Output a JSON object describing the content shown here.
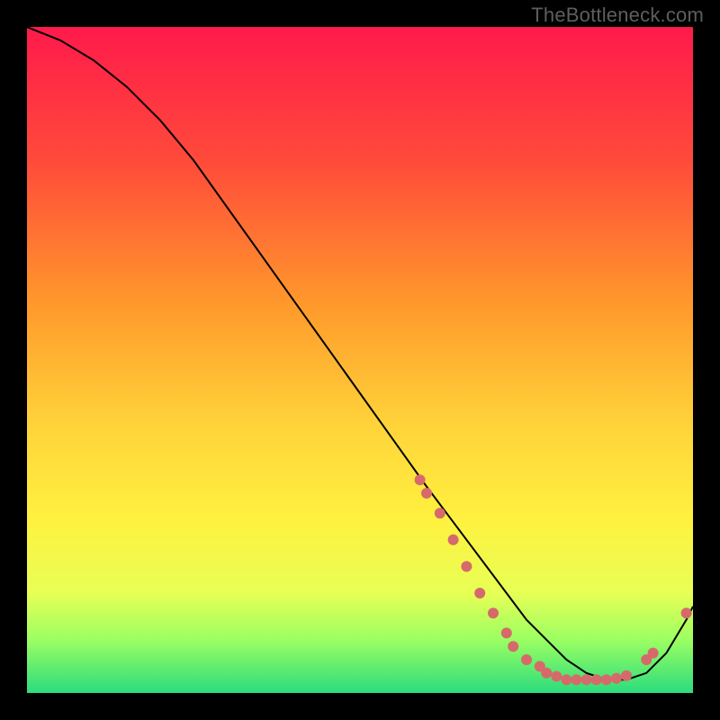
{
  "watermark": "TheBottleneck.com",
  "colors": {
    "bg": "#000000",
    "curve": "#000000",
    "marker": "#d66a6a",
    "gradient_stops": [
      {
        "offset": 0.0,
        "color": "#ff1a4b"
      },
      {
        "offset": 0.2,
        "color": "#ff4a3a"
      },
      {
        "offset": 0.42,
        "color": "#ff9a2b"
      },
      {
        "offset": 0.6,
        "color": "#ffd43a"
      },
      {
        "offset": 0.74,
        "color": "#fff13f"
      },
      {
        "offset": 0.85,
        "color": "#e7ff55"
      },
      {
        "offset": 0.92,
        "color": "#9bff62"
      },
      {
        "offset": 1.0,
        "color": "#2bdc7d"
      }
    ]
  },
  "chart_data": {
    "type": "line",
    "title": "",
    "xlabel": "",
    "ylabel": "",
    "xlim": [
      0,
      100
    ],
    "ylim": [
      0,
      100
    ],
    "series": [
      {
        "name": "curve",
        "x": [
          0,
          5,
          10,
          15,
          20,
          25,
          30,
          35,
          40,
          45,
          50,
          55,
          60,
          63,
          66,
          69,
          72,
          75,
          78,
          81,
          84,
          87,
          90,
          93,
          96,
          99,
          100
        ],
        "y": [
          100,
          98,
          95,
          91,
          86,
          80,
          73,
          66,
          59,
          52,
          45,
          38,
          31,
          27,
          23,
          19,
          15,
          11,
          8,
          5,
          3,
          2,
          2,
          3,
          6,
          11,
          13
        ]
      }
    ],
    "markers": [
      {
        "x": 59,
        "y": 32
      },
      {
        "x": 60,
        "y": 30
      },
      {
        "x": 62,
        "y": 27
      },
      {
        "x": 64,
        "y": 23
      },
      {
        "x": 66,
        "y": 19
      },
      {
        "x": 68,
        "y": 15
      },
      {
        "x": 70,
        "y": 12
      },
      {
        "x": 72,
        "y": 9
      },
      {
        "x": 73,
        "y": 7
      },
      {
        "x": 75,
        "y": 5
      },
      {
        "x": 77,
        "y": 4
      },
      {
        "x": 78,
        "y": 3
      },
      {
        "x": 79.5,
        "y": 2.5
      },
      {
        "x": 81,
        "y": 2
      },
      {
        "x": 82.5,
        "y": 2
      },
      {
        "x": 84,
        "y": 2
      },
      {
        "x": 85.5,
        "y": 2
      },
      {
        "x": 87,
        "y": 2
      },
      {
        "x": 88.5,
        "y": 2.2
      },
      {
        "x": 90,
        "y": 2.6
      },
      {
        "x": 93,
        "y": 5
      },
      {
        "x": 94,
        "y": 6
      },
      {
        "x": 99,
        "y": 12
      }
    ]
  }
}
